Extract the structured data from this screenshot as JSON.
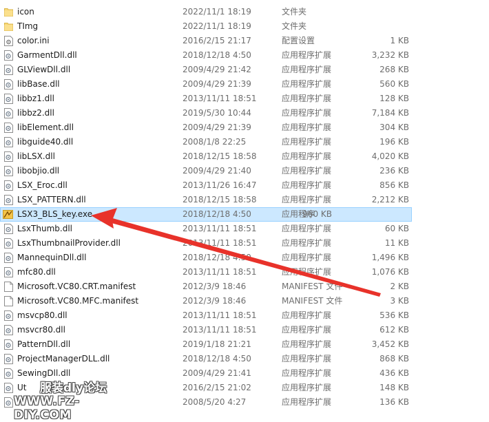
{
  "files": [
    {
      "name": "icon",
      "date": "2022/11/1 18:19",
      "type": "文件夹",
      "size": "",
      "icon": "folder-icon"
    },
    {
      "name": "TImg",
      "date": "2022/11/1 18:19",
      "type": "文件夹",
      "size": "",
      "icon": "folder-icon"
    },
    {
      "name": "color.ini",
      "date": "2016/2/15 21:17",
      "type": "配置设置",
      "size": "1 KB",
      "icon": "config-file-icon"
    },
    {
      "name": "GarmentDll.dll",
      "date": "2018/12/18 4:50",
      "type": "应用程序扩展",
      "size": "3,232 KB",
      "icon": "dll-file-icon"
    },
    {
      "name": "GLViewDll.dll",
      "date": "2009/4/29 21:42",
      "type": "应用程序扩展",
      "size": "268 KB",
      "icon": "dll-file-icon"
    },
    {
      "name": "libBase.dll",
      "date": "2009/4/29 21:39",
      "type": "应用程序扩展",
      "size": "560 KB",
      "icon": "dll-file-icon"
    },
    {
      "name": "libbz1.dll",
      "date": "2013/11/11 18:51",
      "type": "应用程序扩展",
      "size": "128 KB",
      "icon": "dll-file-icon"
    },
    {
      "name": "libbz2.dll",
      "date": "2019/5/30 10:44",
      "type": "应用程序扩展",
      "size": "7,184 KB",
      "icon": "dll-file-icon"
    },
    {
      "name": "libElement.dll",
      "date": "2009/4/29 21:39",
      "type": "应用程序扩展",
      "size": "304 KB",
      "icon": "dll-file-icon"
    },
    {
      "name": "libguide40.dll",
      "date": "2008/1/8 22:25",
      "type": "应用程序扩展",
      "size": "196 KB",
      "icon": "dll-file-icon"
    },
    {
      "name": "libLSX.dll",
      "date": "2018/12/15 18:58",
      "type": "应用程序扩展",
      "size": "4,020 KB",
      "icon": "dll-file-icon"
    },
    {
      "name": "libobjio.dll",
      "date": "2009/4/29 21:40",
      "type": "应用程序扩展",
      "size": "236 KB",
      "icon": "dll-file-icon"
    },
    {
      "name": "LSX_Eroc.dll",
      "date": "2013/11/26 16:47",
      "type": "应用程序扩展",
      "size": "856 KB",
      "icon": "dll-file-icon"
    },
    {
      "name": "LSX_PATTERN.dll",
      "date": "2018/12/15 18:58",
      "type": "应用程序扩展",
      "size": "2,212 KB",
      "icon": "dll-file-icon"
    },
    {
      "name": "LSX3_BLS_key.exe",
      "date": "2018/12/18 4:50",
      "type": "应用程序",
      "size": "960 KB",
      "icon": "exe-app-icon",
      "selected": true
    },
    {
      "name": "LsxThumb.dll",
      "date": "2013/11/11 18:51",
      "type": "应用程序扩展",
      "size": "60 KB",
      "icon": "dll-file-icon"
    },
    {
      "name": "LsxThumbnailProvider.dll",
      "date": "2013/11/11 18:51",
      "type": "应用程序扩展",
      "size": "11 KB",
      "icon": "dll-file-icon"
    },
    {
      "name": "MannequinDll.dll",
      "date": "2018/12/18 4:50",
      "type": "应用程序扩展",
      "size": "1,496 KB",
      "icon": "dll-file-icon"
    },
    {
      "name": "mfc80.dll",
      "date": "2013/11/11 18:51",
      "type": "应用程序扩展",
      "size": "1,076 KB",
      "icon": "dll-file-icon"
    },
    {
      "name": "Microsoft.VC80.CRT.manifest",
      "date": "2012/3/9 18:46",
      "type": "MANIFEST 文件",
      "size": "2 KB",
      "icon": "blank-file-icon"
    },
    {
      "name": "Microsoft.VC80.MFC.manifest",
      "date": "2012/3/9 18:46",
      "type": "MANIFEST 文件",
      "size": "3 KB",
      "icon": "blank-file-icon"
    },
    {
      "name": "msvcp80.dll",
      "date": "2013/11/11 18:51",
      "type": "应用程序扩展",
      "size": "536 KB",
      "icon": "dll-file-icon"
    },
    {
      "name": "msvcr80.dll",
      "date": "2013/11/11 18:51",
      "type": "应用程序扩展",
      "size": "612 KB",
      "icon": "dll-file-icon"
    },
    {
      "name": "PatternDll.dll",
      "date": "2019/1/18 21:21",
      "type": "应用程序扩展",
      "size": "3,452 KB",
      "icon": "dll-file-icon"
    },
    {
      "name": "ProjectManagerDLL.dll",
      "date": "2018/12/18 4:50",
      "type": "应用程序扩展",
      "size": "868 KB",
      "icon": "dll-file-icon"
    },
    {
      "name": "SewingDll.dll",
      "date": "2009/4/29 21:41",
      "type": "应用程序扩展",
      "size": "436 KB",
      "icon": "dll-file-icon"
    },
    {
      "name": "Ut",
      "date": "2016/2/15 21:02",
      "type": "应用程序扩展",
      "size": "148 KB",
      "icon": "dll-file-icon"
    },
    {
      "name": "",
      "date": "2008/5/20 4:27",
      "type": "应用程序扩展",
      "size": "136 KB",
      "icon": "dll-file-icon"
    }
  ],
  "watermark": {
    "line1": "服装dly论坛",
    "line2": "WWW.FZ-DIY.COM"
  },
  "colors": {
    "selection_bg": "#cce8ff",
    "selection_border": "#99d1ff",
    "arrow": "#e8322a",
    "folder": "#f8d775"
  }
}
